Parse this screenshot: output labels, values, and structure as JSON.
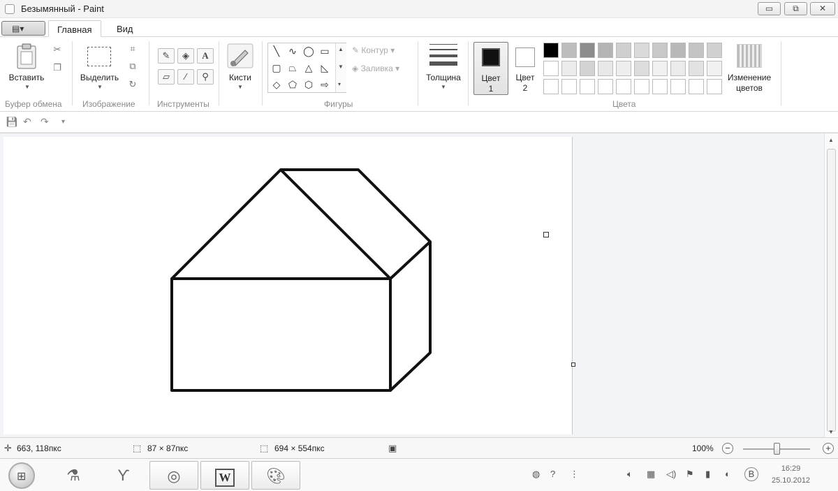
{
  "window": {
    "title": "Безымянный - Paint",
    "min_glyph": "▭",
    "max_glyph": "⧉",
    "close_glyph": "✕"
  },
  "tabs": {
    "file_glyph": "▤▾",
    "home": "Главная",
    "view": "Вид"
  },
  "ribbon": {
    "clipboard": {
      "paste": "Вставить",
      "group": "Буфер обмена"
    },
    "image": {
      "select": "Выделить",
      "group": "Изображение"
    },
    "tools": {
      "group": "Инструменты",
      "text_glyph": "A"
    },
    "brushes": {
      "label": "Кисти"
    },
    "shapes": {
      "outline": "Контур",
      "fill": "Заливка",
      "group": "Фигуры"
    },
    "size": {
      "label": "Толщина"
    },
    "colors": {
      "color1": "Цвет",
      "color1_num": "1",
      "color2": "Цвет",
      "color2_num": "2",
      "edit_line1": "Изменение",
      "edit_line2": "цветов",
      "group": "Цвета",
      "palette_row1": [
        "#000000",
        "#bdbdbd",
        "#8c8c8c",
        "#b4b4b4",
        "#cfcfcf",
        "#dadada",
        "#c8c8c8",
        "#b8b8b8",
        "#c3c3c3",
        "#d0d0d0"
      ],
      "palette_row2": [
        "#ffffff",
        "#ececec",
        "#d2d2d2",
        "#e8e8e8",
        "#eeeeee",
        "#dcdcdc",
        "#f0f0f0",
        "#ebebeb",
        "#e2e2e2",
        "#f1f1f1"
      ],
      "palette_row3": [
        "#ffffff",
        "#ffffff",
        "#ffffff",
        "#ffffff",
        "#ffffff",
        "#ffffff",
        "#ffffff",
        "#ffffff",
        "#ffffff",
        "#ffffff"
      ]
    }
  },
  "status": {
    "cursor_pos": "663, 118пкс",
    "selection_size": "87 × 87пкс",
    "canvas_size": "694 × 554пкс",
    "zoom": "100%",
    "zoom_minus": "−",
    "zoom_plus": "+"
  },
  "taskbar": {
    "word_glyph": "W",
    "keyboard_lang": "В",
    "time": "16:29",
    "date": "25.10.2012"
  }
}
